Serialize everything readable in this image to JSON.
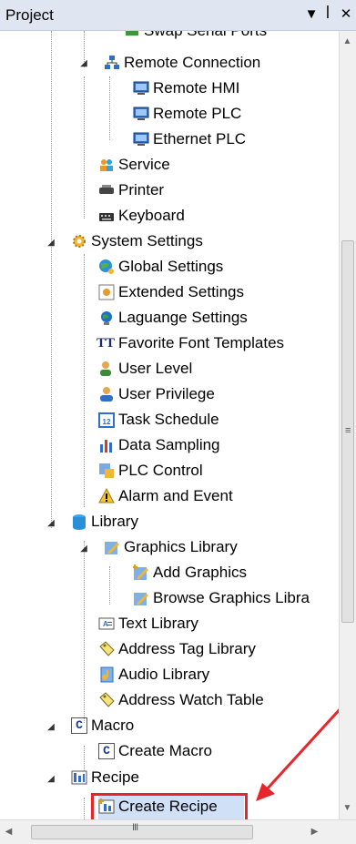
{
  "panel": {
    "title": "Project",
    "pin_glyph": "▾ ╨",
    "close_glyph": "✕"
  },
  "tree": {
    "partial_top": "Swap Serial Ports",
    "remote_connection": "Remote Connection",
    "remote_hmi": "Remote HMI",
    "remote_plc": "Remote PLC",
    "ethernet_plc": "Ethernet PLC",
    "service": "Service",
    "printer": "Printer",
    "keyboard": "Keyboard",
    "system_settings": "System Settings",
    "global_settings": "Global Settings",
    "extended_settings": "Extended Settings",
    "language_settings": "Laguange Settings",
    "favorite_fonts": "Favorite Font Templates",
    "user_level": "User Level",
    "user_privilege": "User Privilege",
    "task_schedule": "Task Schedule",
    "data_sampling": "Data Sampling",
    "plc_control": "PLC Control",
    "alarm_event": "Alarm and Event",
    "library": "Library",
    "graphics_library": "Graphics Library",
    "add_graphics": "Add Graphics",
    "browse_graphics": "Browse Graphics Libra",
    "text_library": "Text Library",
    "address_tag_library": "Address Tag Library",
    "audio_library": "Audio Library",
    "address_watch_table": "Address Watch Table",
    "macro": "Macro",
    "create_macro": "Create Macro",
    "recipe": "Recipe",
    "create_recipe": "Create Recipe"
  },
  "icons": {
    "font_template_glyph": "TT",
    "macro_glyph": "C",
    "task_glyph": "12"
  },
  "scrollbars": {
    "vertical_grip": "≡",
    "horizontal_grip": "III"
  },
  "annotation": {
    "highlight_color": "#e8252a",
    "arrow_color": "#e8252a"
  }
}
